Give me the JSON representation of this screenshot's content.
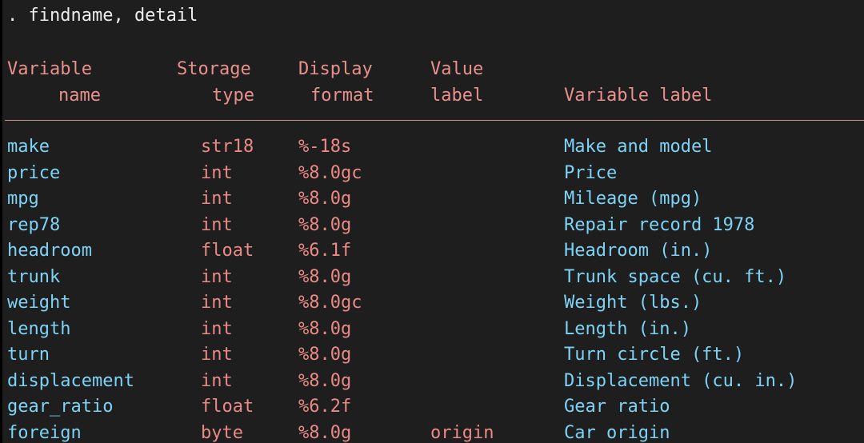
{
  "command": ". findname, detail",
  "headers": {
    "name_line1": "Variable",
    "name_line2": "name",
    "type_line1": "Storage",
    "type_line2": "type",
    "format_line1": "Display",
    "format_line2": "format",
    "valuelabel_line1": "Value",
    "valuelabel_line2": "label",
    "varlabel": "Variable label"
  },
  "rows": [
    {
      "name": "make",
      "type": "str18",
      "format": "%-18s",
      "value_label": "",
      "label": "Make and model"
    },
    {
      "name": "price",
      "type": "int",
      "format": "%8.0gc",
      "value_label": "",
      "label": "Price"
    },
    {
      "name": "mpg",
      "type": "int",
      "format": "%8.0g",
      "value_label": "",
      "label": "Mileage (mpg)"
    },
    {
      "name": "rep78",
      "type": "int",
      "format": "%8.0g",
      "value_label": "",
      "label": "Repair record 1978"
    },
    {
      "name": "headroom",
      "type": "float",
      "format": "%6.1f",
      "value_label": "",
      "label": "Headroom (in.)"
    },
    {
      "name": "trunk",
      "type": "int",
      "format": "%8.0g",
      "value_label": "",
      "label": "Trunk space (cu. ft.)"
    },
    {
      "name": "weight",
      "type": "int",
      "format": "%8.0gc",
      "value_label": "",
      "label": "Weight (lbs.)"
    },
    {
      "name": "length",
      "type": "int",
      "format": "%8.0g",
      "value_label": "",
      "label": "Length (in.)"
    },
    {
      "name": "turn",
      "type": "int",
      "format": "%8.0g",
      "value_label": "",
      "label": "Turn circle (ft.)"
    },
    {
      "name": "displacement",
      "type": "int",
      "format": "%8.0g",
      "value_label": "",
      "label": "Displacement (cu. in.)"
    },
    {
      "name": "gear_ratio",
      "type": "float",
      "format": "%6.2f",
      "value_label": "",
      "label": "Gear ratio"
    },
    {
      "name": "foreign",
      "type": "byte",
      "format": "%8.0g",
      "value_label": "origin",
      "label": "Car origin"
    }
  ],
  "colors": {
    "background": "#1e1e1e",
    "header_text": "#e8918c",
    "variable_text": "#7dd3f5",
    "type_text": "#ea8a86",
    "command_text": "#ececec"
  }
}
